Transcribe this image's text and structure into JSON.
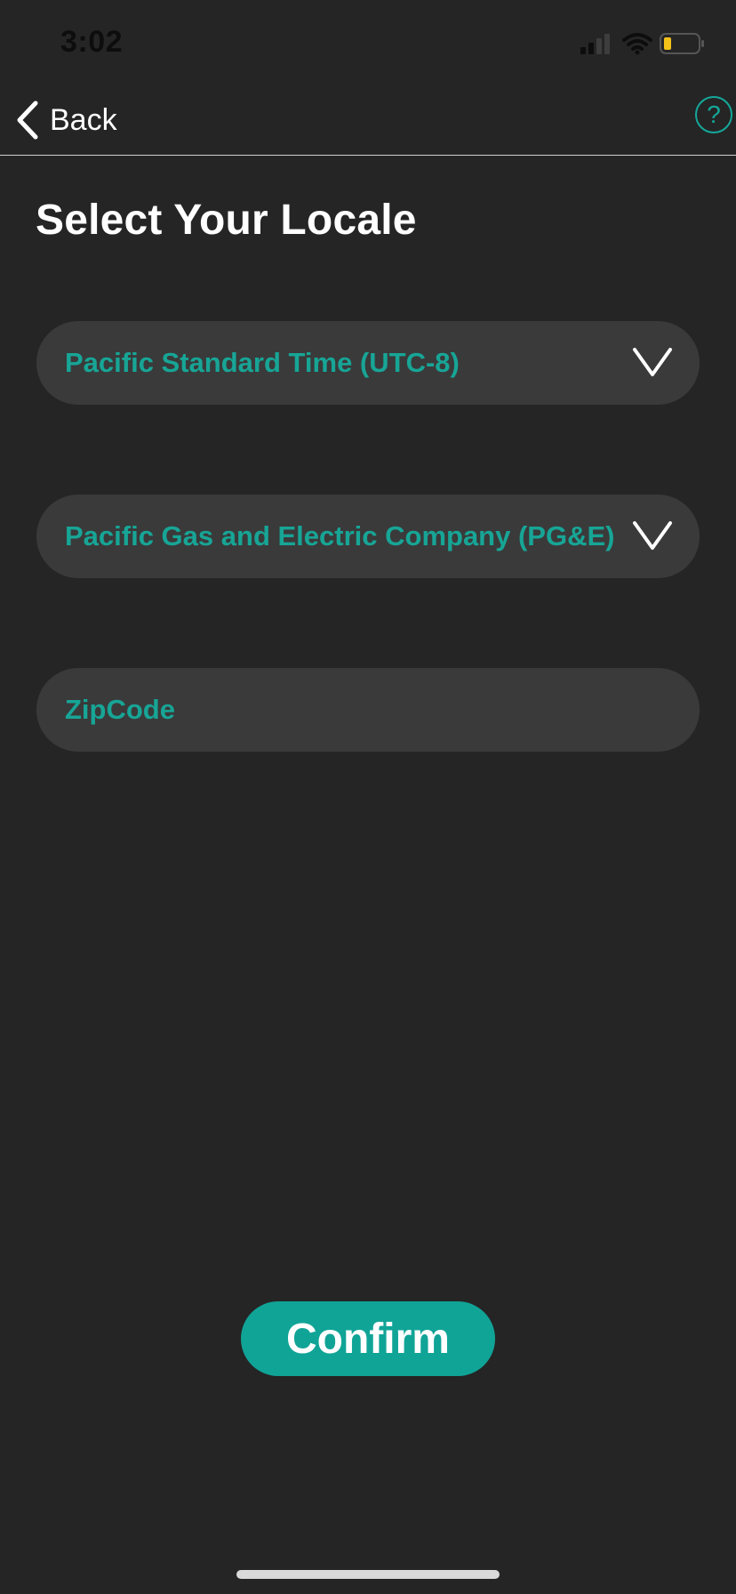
{
  "status_bar": {
    "time": "3:02",
    "icons": [
      "signal-icon",
      "wifi-icon",
      "battery-icon"
    ],
    "battery_color": "#f3c21a"
  },
  "nav": {
    "back_label": "Back",
    "help_label": "?"
  },
  "page": {
    "title": "Select Your Locale"
  },
  "form": {
    "timezone": {
      "value": "Pacific Standard Time (UTC-8)"
    },
    "utility": {
      "value": "Pacific Gas and Electric Company (PG&E)"
    },
    "zipcode": {
      "placeholder": "ZipCode",
      "value": ""
    }
  },
  "actions": {
    "confirm_label": "Confirm"
  },
  "colors": {
    "background": "#252525",
    "accent": "#10a497",
    "field_bg": "#3a3a3a",
    "text_primary": "#ffffff"
  }
}
